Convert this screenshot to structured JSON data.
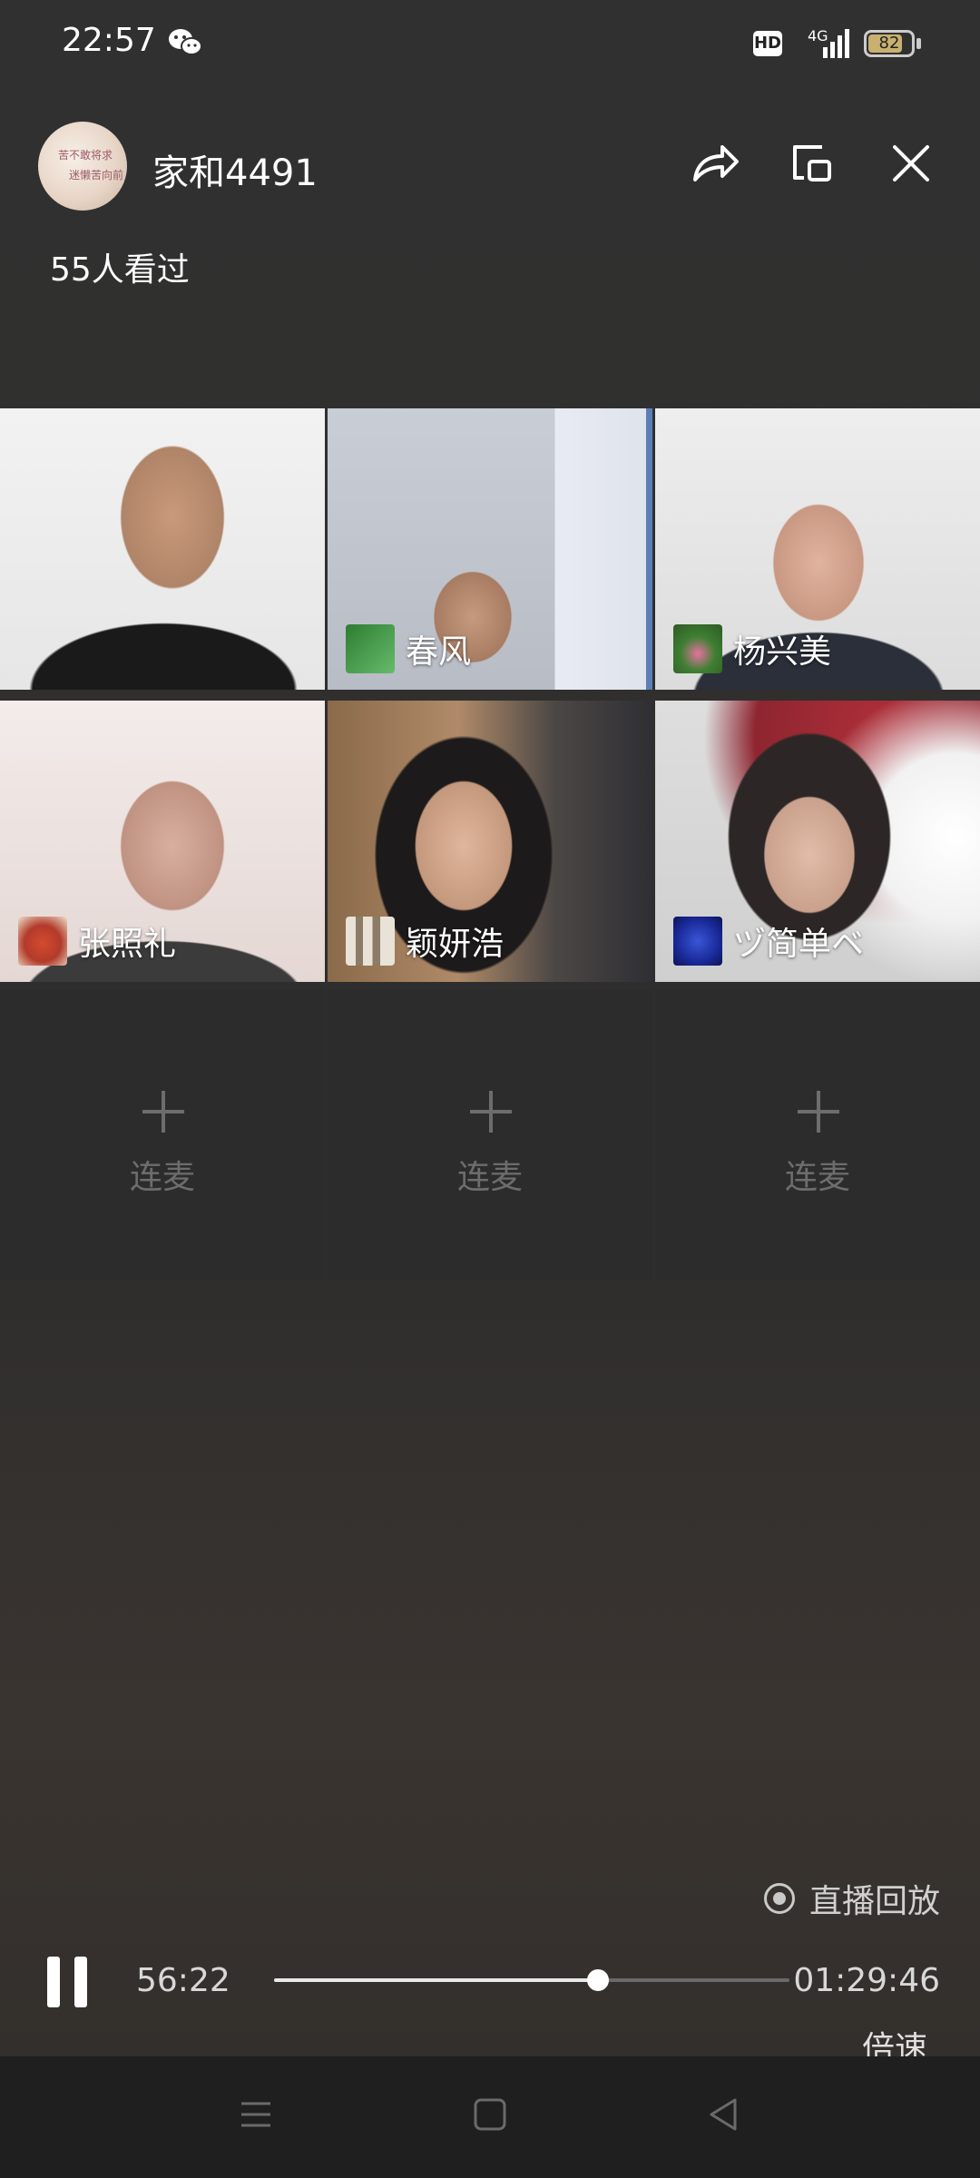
{
  "status_bar": {
    "time": "22:57",
    "hd": "HD",
    "network": "4G",
    "battery": "82",
    "battery_level": 0.82
  },
  "header": {
    "host_name": "家和4491",
    "viewers": "55人看过",
    "avatar_text_1": "苦不敢将求",
    "avatar_text_2": "迷懒苦向前"
  },
  "participants": [
    {
      "name": "",
      "avatar_color": ""
    },
    {
      "name": "春风",
      "avatar_color": "#2e7d32"
    },
    {
      "name": "杨兴美",
      "avatar_color": "#3f7f33"
    },
    {
      "name": "张照礼",
      "avatar_color": "#b23b2a"
    },
    {
      "name": "颖妍浩",
      "avatar_color": "#8a7c66"
    },
    {
      "name": "ヅ简单ベ",
      "avatar_color": "#1a2a9a"
    }
  ],
  "empty_slots": [
    {
      "label": "连麦"
    },
    {
      "label": "连麦"
    },
    {
      "label": "连麦"
    }
  ],
  "player": {
    "replay_label": "直播回放",
    "current_time": "56:22",
    "total_time": "01:29:46",
    "progress": 0.628,
    "speed_label": "倍速"
  }
}
